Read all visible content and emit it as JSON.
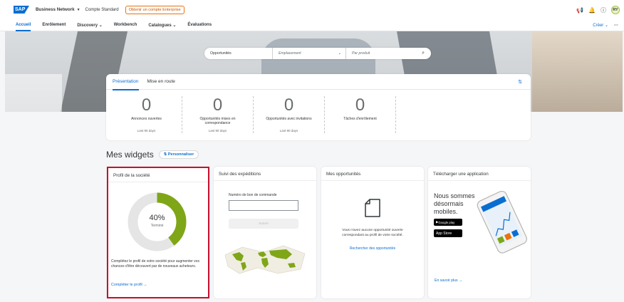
{
  "topbar": {
    "logo": "SAP",
    "network": "Business Network",
    "account": "Compte Standard",
    "enterprise_button": "Obtenir un compte Enterprise",
    "avatar": "RY"
  },
  "nav": {
    "items": [
      {
        "label": "Accueil",
        "active": true
      },
      {
        "label": "Enrôlement"
      },
      {
        "label": "Discovery ⌄"
      },
      {
        "label": "Workbench"
      },
      {
        "label": "Catalogues ⌄"
      },
      {
        "label": "Évaluations"
      }
    ],
    "create": "Créer ⌄",
    "more": "···"
  },
  "search": {
    "category": "Opportunités",
    "location_placeholder": "Emplacement",
    "product_placeholder": "Par produit"
  },
  "presentation": {
    "tabs": [
      "Présentation",
      "Mise en route"
    ],
    "stats": [
      {
        "value": "0",
        "label": "Annonces ouvertes",
        "period": "Last 90 days"
      },
      {
        "value": "0",
        "label": "Opportunités mises en correspondance",
        "period": "Last 90 days"
      },
      {
        "value": "0",
        "label": "Opportunités avec invitations",
        "period": "Last 90 days"
      },
      {
        "value": "0",
        "label": "Tâches d'enrôlement",
        "period": ""
      }
    ]
  },
  "widgets": {
    "title": "Mes widgets",
    "personalize": "Personnaliser",
    "profile": {
      "header": "Profil de la société",
      "percent": "40%",
      "progress": 0.4,
      "status": "Terminé",
      "description": "Complétez le profil de votre société pour augmenter vos chances d'être découvert par de nouveaux acheteurs.",
      "link": "Compléter le profil →"
    },
    "shipments": {
      "header": "Suivi des expéditions",
      "po_label": "Numéro de bon de commande",
      "button": "Suivre"
    },
    "opportunities": {
      "header": "Mes opportunités",
      "message": "Vous n'avez aucune opportunité ouverte correspondant au profil de votre société.",
      "link": "Rechercher des opportunités"
    },
    "app": {
      "header": "Télécharger une application",
      "text": "Nous sommes désormais mobiles.",
      "google": "Google play",
      "apple": "App Store",
      "link": "En savoir plus →"
    }
  },
  "colors": {
    "accent": "#0a6ed1",
    "donut_fill": "#7fa617",
    "donut_track": "#e5e5e5",
    "highlight_border": "#c8102e"
  }
}
